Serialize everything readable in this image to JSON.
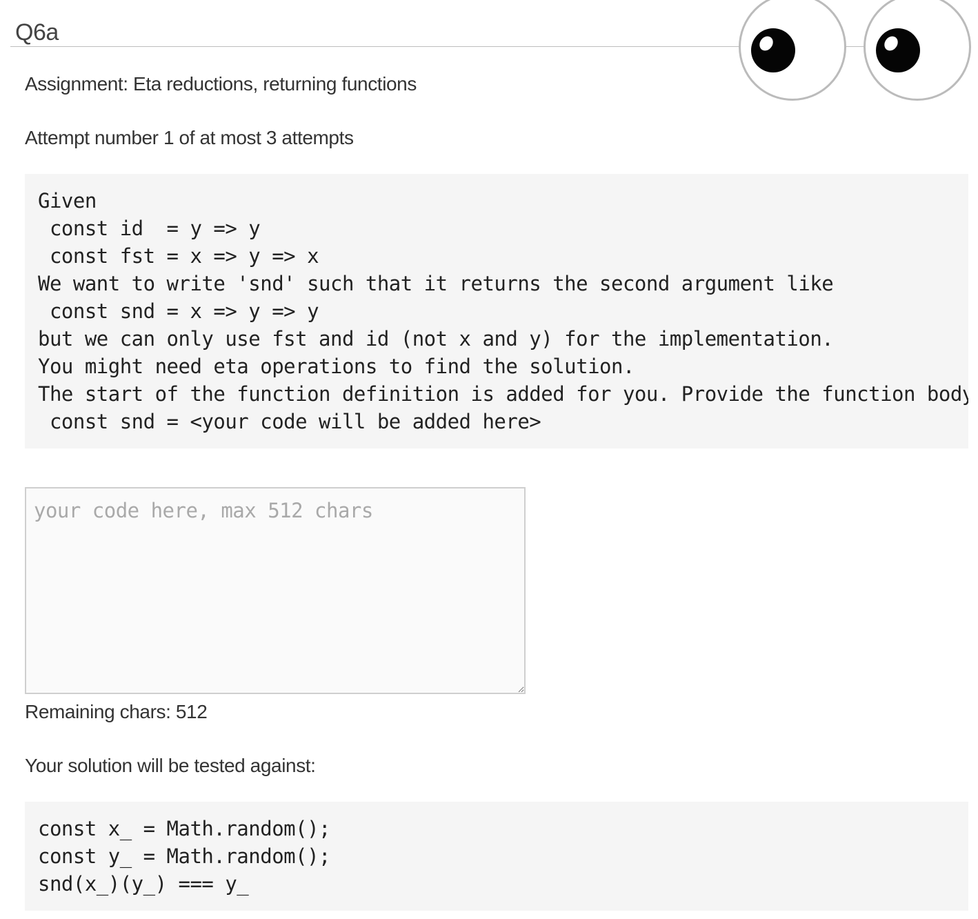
{
  "page": {
    "title": "Q6a"
  },
  "assignment": {
    "text": "Assignment: Eta reductions, returning functions"
  },
  "attempt": {
    "text": "Attempt number 1 of at most 3 attempts"
  },
  "problem": {
    "code": "Given\n const id  = y => y\n const fst = x => y => x\nWe want to write 'snd' such that it returns the second argument like\n const snd = x => y => y\nbut we can only use fst and id (not x and y) for the implementation.\nYou might need eta operations to find the solution.\nThe start of the function definition is added for you. Provide the function body\n const snd = <your code will be added here>"
  },
  "answer": {
    "value": "",
    "placeholder": "your code here, max 512 chars"
  },
  "remaining": {
    "text": "Remaining chars: 512"
  },
  "tests": {
    "heading": "Your solution will be tested against:",
    "code": "const x_ = Math.random();\nconst y_ = Math.random();\nsnd(x_)(y_) === y_"
  },
  "icons": {
    "eyes": "googly-eyes-icon"
  }
}
